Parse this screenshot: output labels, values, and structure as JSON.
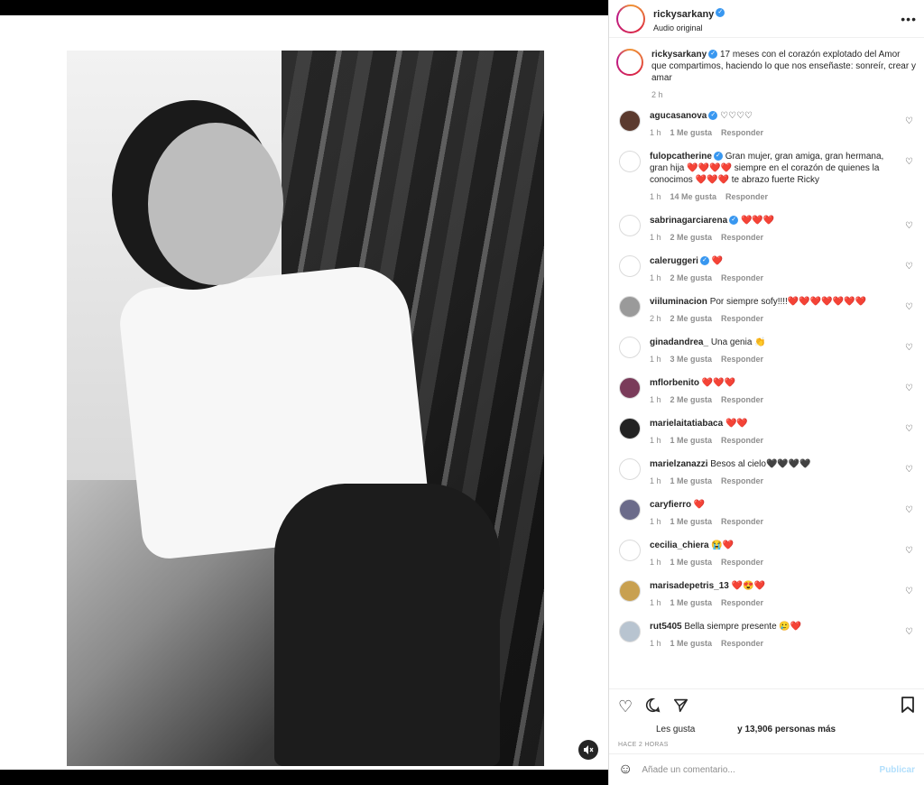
{
  "post": {
    "username": "rickysarkany",
    "audio": "Audio original",
    "caption": "17 meses con el corazón explotado del Amor que compartimos, haciendo lo que nos enseñaste: sonreír, crear y amar",
    "caption_time": "2 h",
    "more_icon": "more-options-icon"
  },
  "comments": [
    {
      "user": "agucasanova",
      "verified": true,
      "text": "♡♡♡♡",
      "time": "1 h",
      "likes": "1 Me gusta",
      "reply": "Responder",
      "avatar_color": "#5b3a2e"
    },
    {
      "user": "fulopcatherine",
      "verified": true,
      "text": "Gran mujer, gran amiga, gran hermana, gran hija ❤️❤️❤️❤️ siempre en el corazón de quienes la conocimos ❤️❤️❤️ te abrazo fuerte Ricky",
      "time": "1 h",
      "likes": "14 Me gusta",
      "reply": "Responder",
      "avatar_color": "#ffffff"
    },
    {
      "user": "sabrinagarciarena",
      "verified": true,
      "text": "❤️❤️❤️",
      "time": "1 h",
      "likes": "2 Me gusta",
      "reply": "Responder",
      "avatar_color": "#ffffff"
    },
    {
      "user": "caleruggeri",
      "verified": true,
      "text": "❤️",
      "time": "1 h",
      "likes": "2 Me gusta",
      "reply": "Responder",
      "avatar_color": "#ffffff"
    },
    {
      "user": "viiluminacion",
      "verified": false,
      "text": "Por siempre sofy!!!!❤️❤️❤️❤️❤️❤️❤️",
      "time": "2 h",
      "likes": "2 Me gusta",
      "reply": "Responder",
      "avatar_color": "#9a9a9a"
    },
    {
      "user": "ginadandrea_",
      "verified": false,
      "text": "Una genia 👏",
      "time": "1 h",
      "likes": "3 Me gusta",
      "reply": "Responder",
      "avatar_color": "#ffffff"
    },
    {
      "user": "mflorbenito",
      "verified": false,
      "text": "❤️❤️❤️",
      "time": "1 h",
      "likes": "2 Me gusta",
      "reply": "Responder",
      "avatar_color": "#7a3b5a"
    },
    {
      "user": "marielaitatiabaca",
      "verified": false,
      "text": "❤️❤️",
      "time": "1 h",
      "likes": "1 Me gusta",
      "reply": "Responder",
      "avatar_color": "#222222"
    },
    {
      "user": "marielzanazzi",
      "verified": false,
      "text": "Besos al cielo🖤🖤🖤🖤",
      "time": "1 h",
      "likes": "1 Me gusta",
      "reply": "Responder",
      "avatar_color": "#ffffff"
    },
    {
      "user": "caryfierro",
      "verified": false,
      "text": "❤️",
      "time": "1 h",
      "likes": "1 Me gusta",
      "reply": "Responder",
      "avatar_color": "#6b6b8a"
    },
    {
      "user": "cecilia_chiera",
      "verified": false,
      "text": "😭❤️",
      "time": "1 h",
      "likes": "1 Me gusta",
      "reply": "Responder",
      "avatar_color": "#ffffff"
    },
    {
      "user": "marisadepetris_13",
      "verified": false,
      "text": "❤️😍❤️",
      "time": "1 h",
      "likes": "1 Me gusta",
      "reply": "Responder",
      "avatar_color": "#c8a050"
    },
    {
      "user": "rut5405",
      "verified": false,
      "text": "Bella siempre presente 🥲❤️",
      "time": "1 h",
      "likes": "1 Me gusta",
      "reply": "Responder",
      "avatar_color": "#b8c4d0"
    }
  ],
  "actions": {
    "likes_prefix": "Les gusta",
    "likes_suffix": "y 13,906 personas más",
    "posted": "HACE 2 HORAS"
  },
  "add_comment": {
    "placeholder": "Añade un comentario...",
    "publish": "Publicar"
  }
}
